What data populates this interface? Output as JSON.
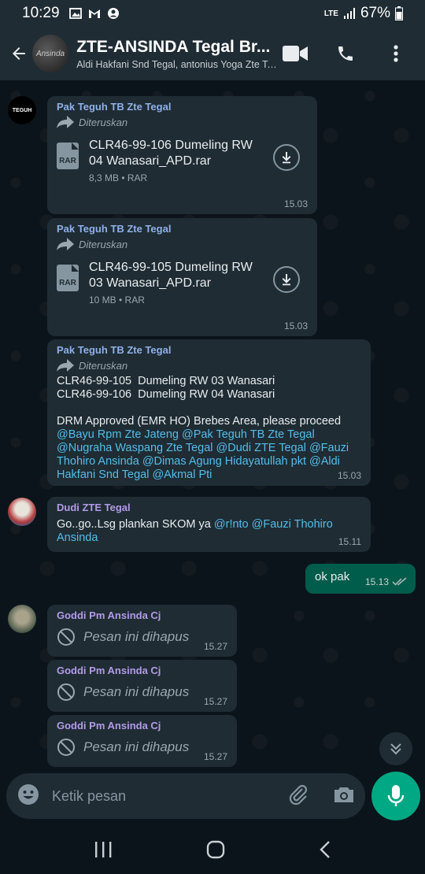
{
  "status": {
    "time": "10:29",
    "battery": "67%",
    "network": "LTE"
  },
  "header": {
    "title": "ZTE-ANSINDA Tegal Br...",
    "subtitle": "Aldi Hakfani Snd Tegal, antonius Yoga Zte Teg...",
    "avatar_text": "Ansinda"
  },
  "messages": {
    "m1": {
      "sender": "Pak Teguh TB Zte Tegal",
      "forwarded": "Diteruskan",
      "file_name": "CLR46-99-106 Dumeling RW 04 Wanasari_APD.rar",
      "file_meta": "8,3 MB • RAR",
      "file_type": "RAR",
      "time": "15.03",
      "avatar_text": "TEGUH"
    },
    "m2": {
      "sender": "Pak Teguh TB Zte Tegal",
      "forwarded": "Diteruskan",
      "file_name": "CLR46-99-105 Dumeling RW 03 Wanasari_APD.rar",
      "file_meta": "10 MB • RAR",
      "file_type": "RAR",
      "time": "15.03"
    },
    "m3": {
      "sender": "Pak Teguh TB Zte Tegal",
      "forwarded": "Diteruskan",
      "line1": "CLR46-99-105  Dumeling RW 03 Wanasari",
      "line2": "CLR46-99-106  Dumeling RW 04 Wanasari",
      "line3": "DRM Approved (EMR HO) Brebes Area, please proceed",
      "mentions": "@Bayu Rpm Zte Jateng @Pak Teguh TB Zte Tegal @Nugraha Waspang Zte Tegal @Dudi ZTE Tegal @Fauzi Thohiro Ansinda @Dimas Agung Hidayatullah pkt @Aldi Hakfani Snd Tegal @Akmal Pti",
      "time": "15.03"
    },
    "m4": {
      "sender": "Dudi ZTE Tegal",
      "text": "Go..go..Lsg plankan SKOM ya ",
      "mentions": "@r!nto @Fauzi Thohiro Ansinda",
      "time": "15.11"
    },
    "m5": {
      "text": "ok pak",
      "time": "15.13"
    },
    "m6": {
      "sender": "Goddi Pm Ansinda Cj",
      "text": "Pesan ini dihapus",
      "time": "15.27"
    },
    "m7": {
      "sender": "Goddi Pm Ansinda Cj",
      "text": "Pesan ini dihapus",
      "time": "15.27"
    },
    "m8": {
      "sender": "Goddi Pm Ansinda Cj",
      "text": "Pesan ini dihapus",
      "time": "15.27"
    }
  },
  "composer": {
    "placeholder": "Ketik pesan"
  },
  "colors": {
    "accent": "#00a884",
    "mention": "#53bdeb",
    "bubble_in": "#1f2c34",
    "bubble_out": "#005c4b"
  }
}
